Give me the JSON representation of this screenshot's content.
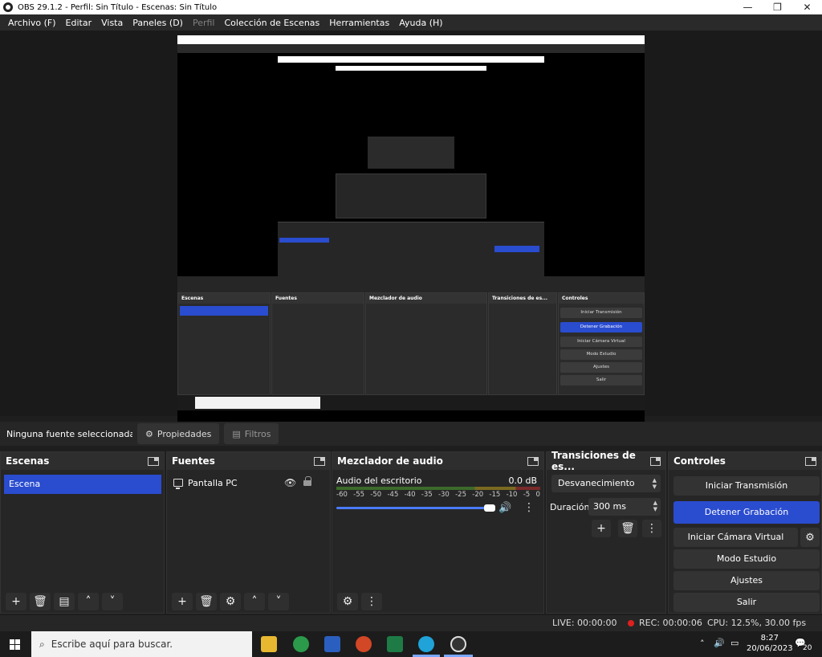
{
  "window": {
    "title": "OBS 29.1.2 - Perfil: Sin Título - Escenas: Sin Título",
    "controls": [
      "minimize",
      "maximize",
      "close"
    ]
  },
  "menubar": {
    "items": [
      {
        "label": "Archivo (F)",
        "enabled": true
      },
      {
        "label": "Editar",
        "enabled": true
      },
      {
        "label": "Vista",
        "enabled": true
      },
      {
        "label": "Paneles (D)",
        "enabled": true
      },
      {
        "label": "Perfil",
        "enabled": false
      },
      {
        "label": "Colección de Escenas",
        "enabled": true
      },
      {
        "label": "Herramientas",
        "enabled": true
      },
      {
        "label": "Ayuda (H)",
        "enabled": true
      }
    ]
  },
  "source_bar": {
    "no_source": "Ninguna fuente seleccionada",
    "properties": "Propiedades",
    "filters": "Filtros"
  },
  "scenes": {
    "title": "Escenas",
    "items": [
      "Escena"
    ],
    "selected": 0
  },
  "sources": {
    "title": "Fuentes",
    "items": [
      {
        "name": "Pantalla PC",
        "visible": true,
        "locked": false
      }
    ]
  },
  "mixer": {
    "title": "Mezclador de audio",
    "track_name": "Audio del escritorio",
    "db": "0.0 dB",
    "scale": [
      "-60",
      "-55",
      "-50",
      "-45",
      "-40",
      "-35",
      "-30",
      "-25",
      "-20",
      "-15",
      "-10",
      "-5",
      "0"
    ],
    "volume": 0.97
  },
  "transitions": {
    "title": "Transiciones de es...",
    "selected": "Desvanecimiento",
    "duration_label": "Duración",
    "duration": "300 ms"
  },
  "controls": {
    "title": "Controles",
    "start_stream": "Iniciar Transmisión",
    "stop_record": "Detener Grabación",
    "start_virtualcam": "Iniciar Cámara Virtual",
    "studio_mode": "Modo Estudio",
    "settings": "Ajustes",
    "exit": "Salir"
  },
  "status": {
    "live": "LIVE: 00:00:00",
    "rec": "REC: 00:00:06",
    "cpu": "CPU: 12.5%, 30.00 fps"
  },
  "taskbar": {
    "search_placeholder": "Escribe aquí para buscar.",
    "time": "8:27",
    "date": "20/06/2023",
    "notification_count": "20"
  },
  "colors": {
    "accent": "#2a4ccf",
    "background": "#1e1e1e",
    "panel": "#262626",
    "rec_dot": "#e02020"
  }
}
